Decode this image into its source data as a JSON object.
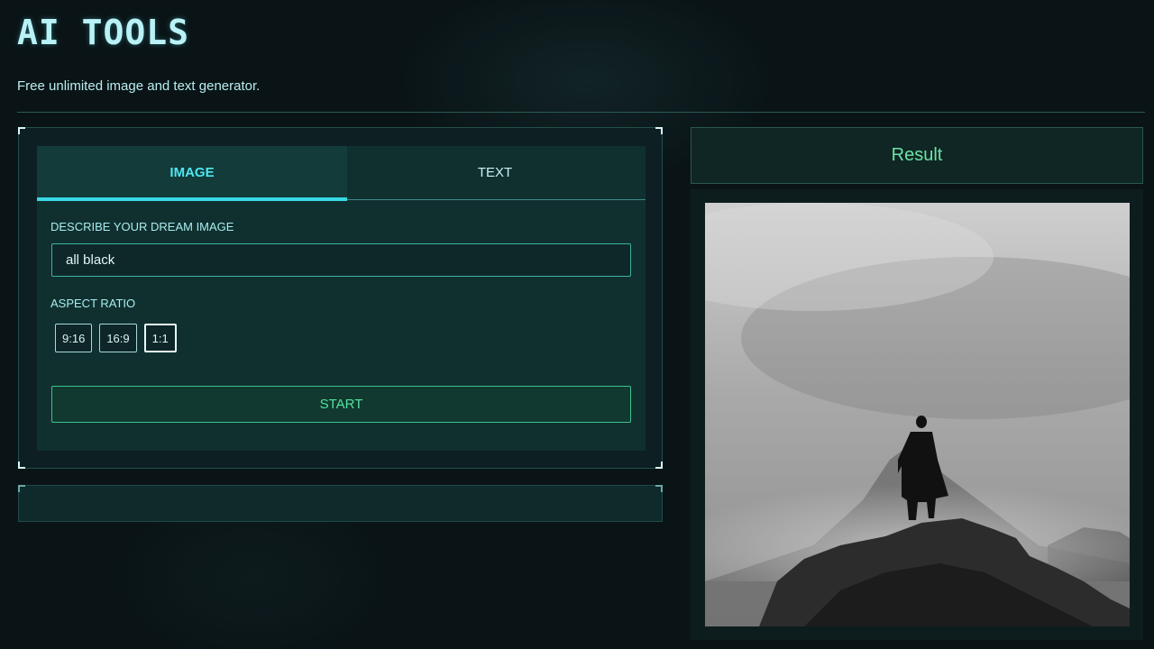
{
  "header": {
    "title": "AI TOOLS",
    "subtitle": "Free unlimited image and text generator."
  },
  "tabs": [
    {
      "label": "IMAGE",
      "active": true
    },
    {
      "label": "TEXT",
      "active": false
    }
  ],
  "form": {
    "prompt_label": "DESCRIBE YOUR DREAM IMAGE",
    "prompt_value": "all black",
    "ratio_label": "ASPECT RATIO",
    "ratios": [
      {
        "label": "9:16",
        "selected": false
      },
      {
        "label": "16:9",
        "selected": false
      },
      {
        "label": "1:1",
        "selected": true
      }
    ],
    "start_label": "START"
  },
  "result": {
    "title": "Result",
    "image_alt": "Misty mountain peak with silhouetted figure"
  },
  "colors": {
    "accent_cyan": "#38d8e6",
    "accent_green": "#52e39e",
    "background": "#0a1417"
  }
}
